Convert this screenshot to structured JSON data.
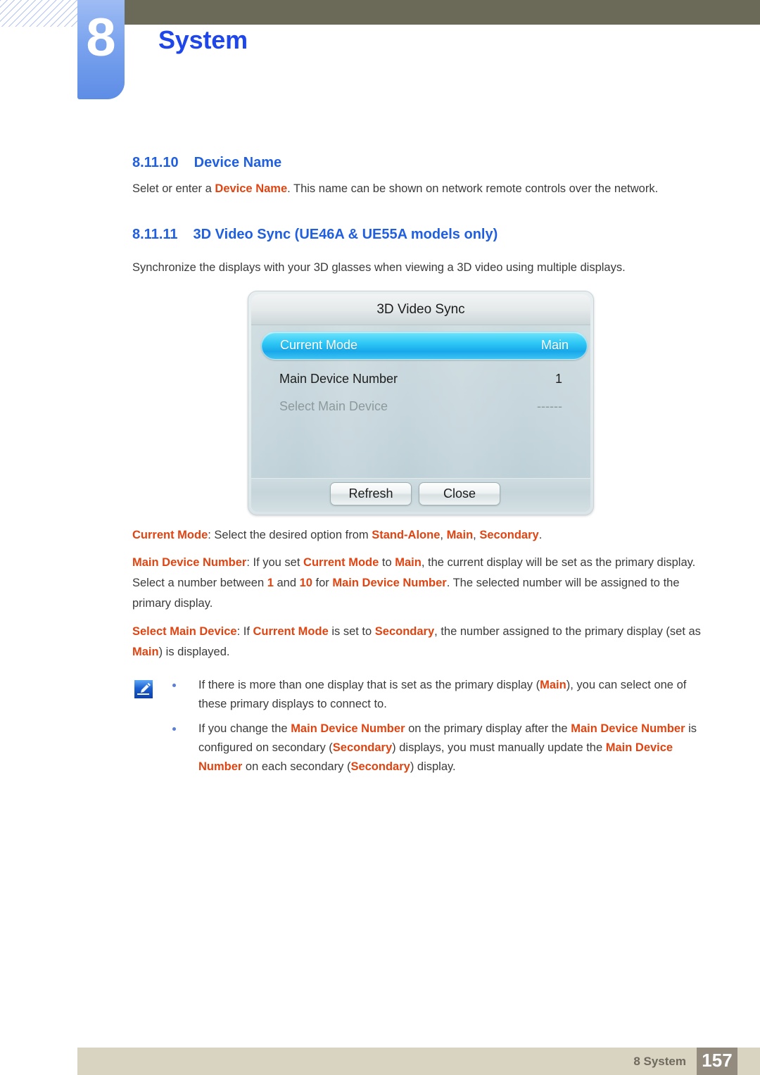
{
  "header": {
    "chapter_number": "8",
    "chapter_title": "System"
  },
  "sections": [
    {
      "number": "8.11.10",
      "title": "Device Name",
      "body_prefix": "Selet or enter a ",
      "body_keyword": "Device Name",
      "body_suffix": ". This name can be shown on network remote controls over the network."
    },
    {
      "number": "8.11.11",
      "title": "3D Video Sync (UE46A & UE55A models only)",
      "body": "Synchronize the displays with your 3D glasses when viewing a 3D video using multiple displays."
    }
  ],
  "osd": {
    "title": "3D Video Sync",
    "rows": [
      {
        "label": "Current Mode",
        "value": "Main",
        "state": "highlighted"
      },
      {
        "label": "Main Device Number",
        "value": "1",
        "state": "normal"
      },
      {
        "label": "Select Main Device",
        "value": "------",
        "state": "disabled"
      }
    ],
    "buttons": {
      "refresh": "Refresh",
      "close": "Close"
    }
  },
  "descriptions": {
    "current_mode": {
      "term": "Current Mode",
      "t1": ": Select the desired option from ",
      "k1": "Stand-Alone",
      "t2": ", ",
      "k2": "Main",
      "t3": ", ",
      "k3": "Secondary",
      "t4": "."
    },
    "main_device_number": {
      "term": "Main Device Number",
      "t1": ": If you set ",
      "k1": "Current Mode",
      "t2": " to ",
      "k2": "Main",
      "t3": ", the current display will be set as the primary display. Select a number between ",
      "k3": "1",
      "t4": " and ",
      "k4": "10",
      "t5": " for ",
      "k5": "Main Device Number",
      "t6": ". The selected number will be assigned to the primary display."
    },
    "select_main_device": {
      "term": "Select Main Device",
      "t1": ": If ",
      "k1": "Current Mode",
      "t2": " is set to ",
      "k2": "Secondary",
      "t3": ", the number assigned to the primary display (set as ",
      "k3": "Main",
      "t4": ") is displayed."
    }
  },
  "notes": {
    "icon": "note-pen-icon",
    "items": [
      {
        "t1": "If there is more than one display that is set as the primary display (",
        "k1": "Main",
        "t2": "), you can select one of these primary displays to connect to."
      },
      {
        "t1": "If you change the ",
        "k1": "Main Device Number",
        "t2": " on the primary display after the ",
        "k2": "Main Device Number",
        "t3": " is configured on secondary (",
        "k3": "Secondary",
        "t4": ") displays, you must manually update the ",
        "k4": "Main Device Number",
        "t5": " on each secondary (",
        "k5": "Secondary",
        "t6": ") display."
      }
    ]
  },
  "footer": {
    "label": "8 System",
    "page_number": "157"
  },
  "colors": {
    "heading_blue": "#1f5fe0",
    "title_blue": "#1f46e8",
    "keyword_orange": "#df4512",
    "olive_bar": "#6b6a58",
    "badge_blue": "#7aa3ee",
    "footer_bar": "#d9d3c2",
    "footer_page_box": "#938b7e",
    "osd_highlight": "#18a8ea"
  }
}
